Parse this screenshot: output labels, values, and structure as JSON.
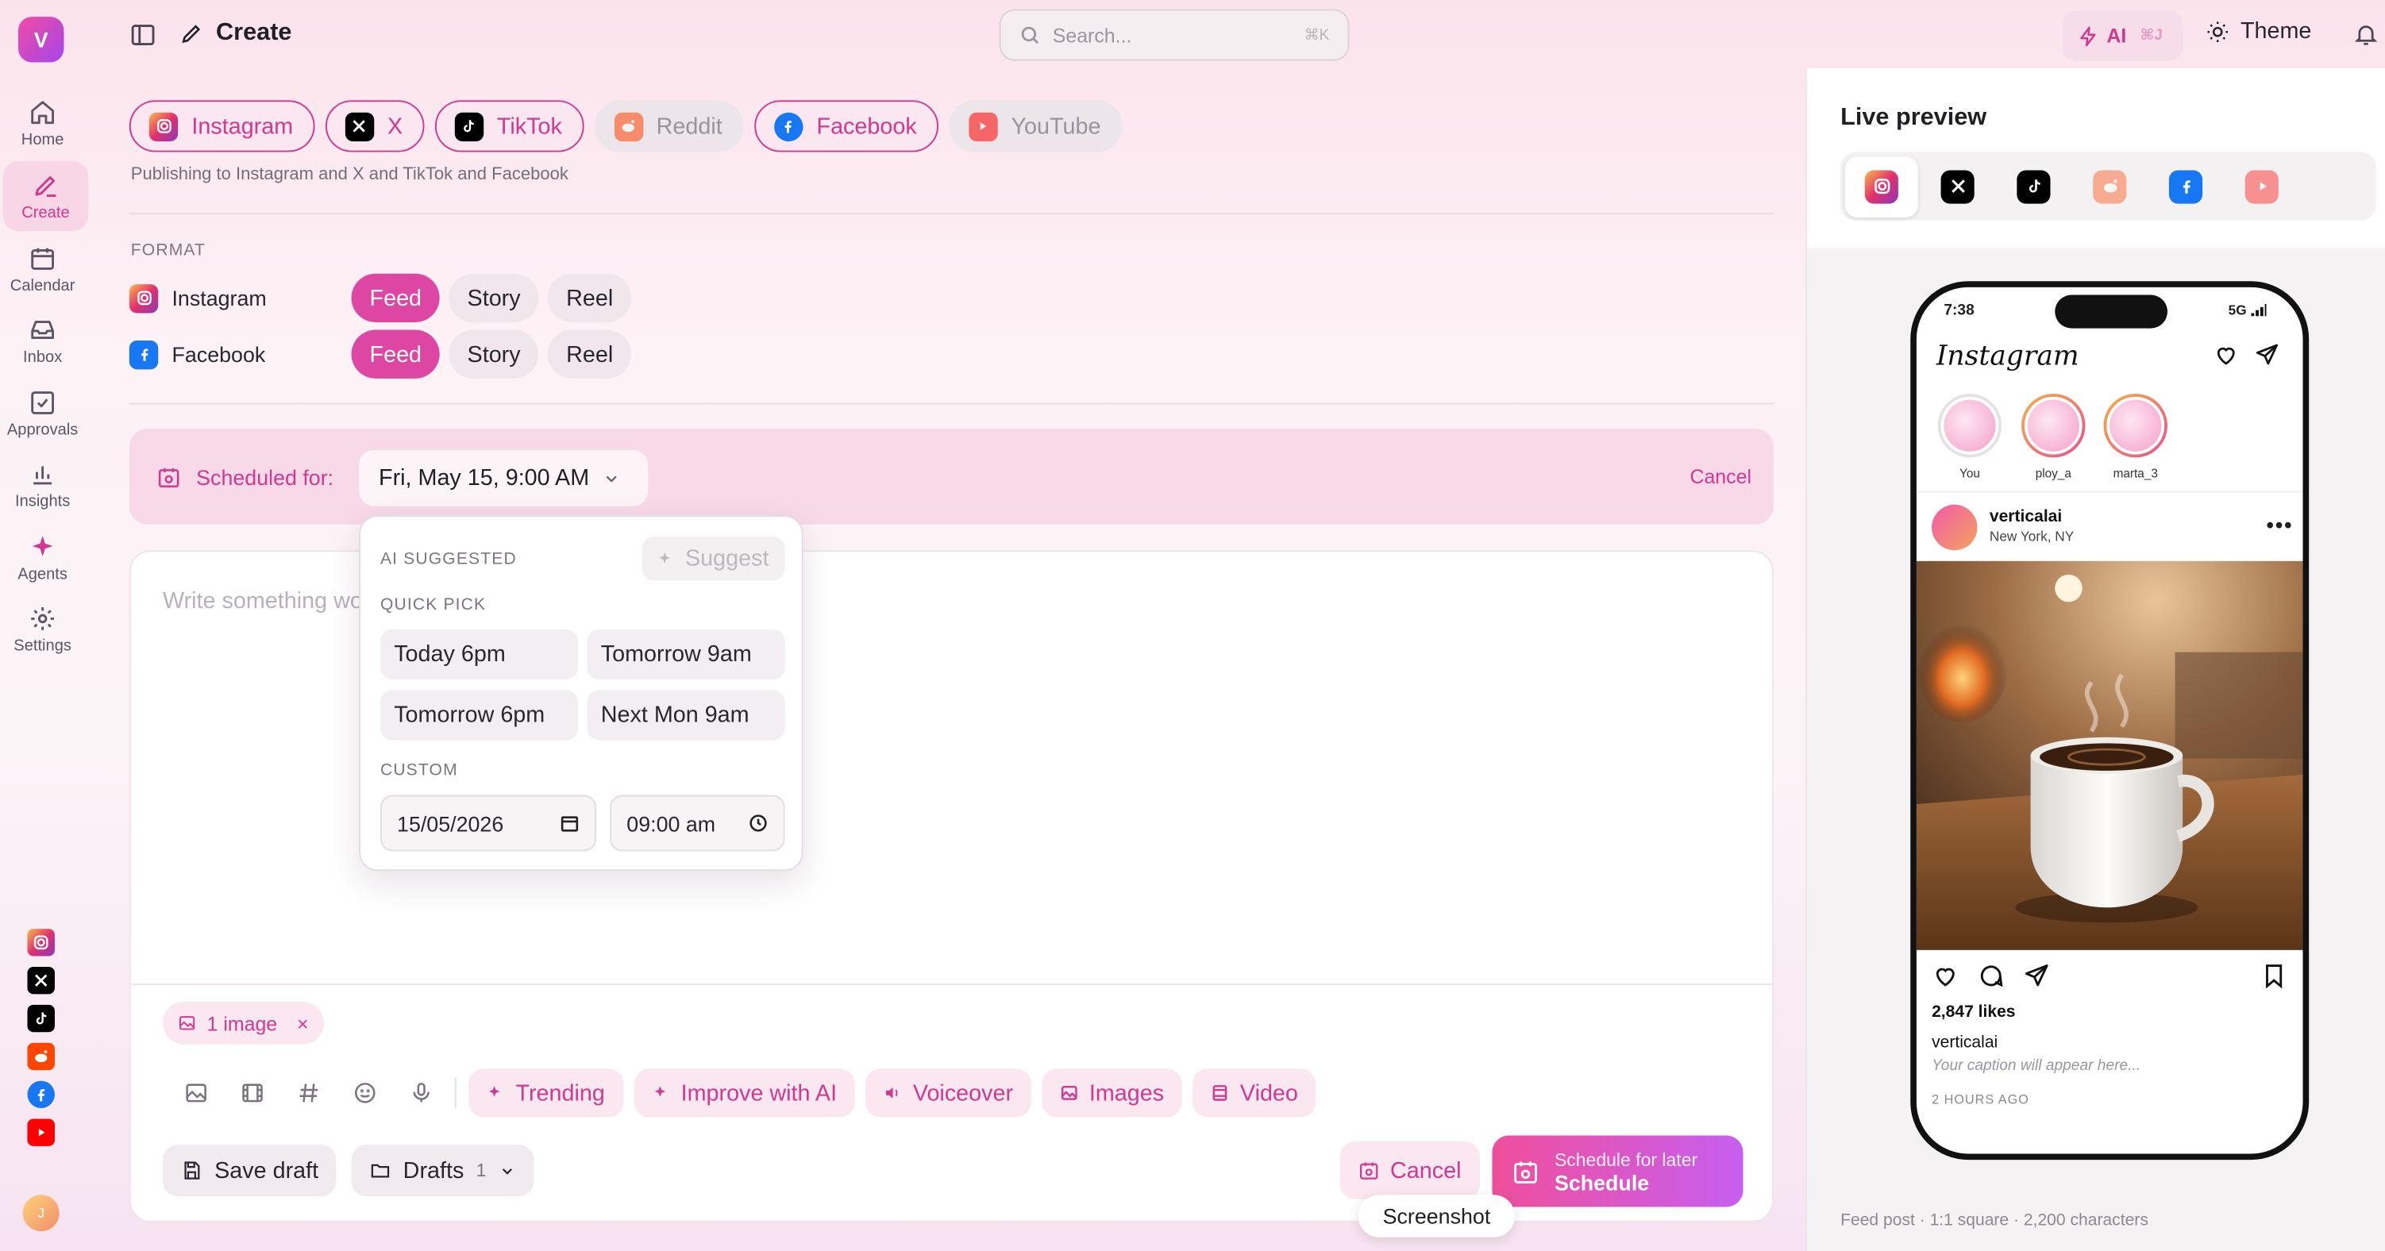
{
  "app": {
    "logo_letter": "V",
    "user_initial": "J"
  },
  "sidebar": {
    "items": [
      {
        "label": "Home",
        "icon": "home-icon"
      },
      {
        "label": "Create",
        "icon": "pencil-icon"
      },
      {
        "label": "Calendar",
        "icon": "calendar-icon"
      },
      {
        "label": "Inbox",
        "icon": "inbox-icon"
      },
      {
        "label": "Approvals",
        "icon": "check-square-icon"
      },
      {
        "label": "Insights",
        "icon": "bar-chart-icon"
      },
      {
        "label": "Agents",
        "icon": "sparkle-icon"
      },
      {
        "label": "Settings",
        "icon": "gear-icon"
      }
    ],
    "active": "Create"
  },
  "header": {
    "title": "Create",
    "search_placeholder": "Search...",
    "search_shortcut": "⌘K",
    "ai_label": "AI",
    "ai_shortcut": "⌘J",
    "theme_label": "Theme"
  },
  "platforms": {
    "chips": [
      {
        "label": "Instagram",
        "selected": true
      },
      {
        "label": "X",
        "selected": true
      },
      {
        "label": "TikTok",
        "selected": true
      },
      {
        "label": "Reddit",
        "selected": false
      },
      {
        "label": "Facebook",
        "selected": true
      },
      {
        "label": "YouTube",
        "selected": false
      }
    ],
    "publishing_text": "Publishing to Instagram and X and TikTok and Facebook"
  },
  "format": {
    "label": "FORMAT",
    "rows": [
      {
        "platform": "Instagram",
        "options": [
          "Feed",
          "Story",
          "Reel"
        ],
        "selected": "Feed"
      },
      {
        "platform": "Facebook",
        "options": [
          "Feed",
          "Story",
          "Reel"
        ],
        "selected": "Feed"
      }
    ]
  },
  "schedule": {
    "label": "Scheduled for:",
    "value": "Fri, May 15, 9:00 AM",
    "cancel": "Cancel",
    "dropdown": {
      "ai_label": "AI SUGGESTED",
      "suggest_label": "Suggest",
      "quick_label": "QUICK PICK",
      "quick": [
        "Today 6pm",
        "Tomorrow 9am",
        "Tomorrow 6pm",
        "Next Mon 9am"
      ],
      "custom_label": "CUSTOM",
      "date": "15/05/2026",
      "time": "09:00 am"
    }
  },
  "editor": {
    "placeholder": "Write something wo",
    "attachment": "1 image",
    "ai_tools": [
      "Trending",
      "Improve with AI",
      "Voiceover",
      "Images",
      "Video"
    ],
    "save_draft": "Save draft",
    "drafts": "Drafts",
    "drafts_count": "1",
    "cancel": "Cancel",
    "primary_sub": "Schedule for later",
    "primary_main": "Schedule",
    "tooltip": "Screenshot"
  },
  "preview": {
    "title": "Live preview",
    "time": "7:38",
    "network": "5G",
    "app_name": "Instagram",
    "stories": [
      "You",
      "ploy_a",
      "marta_3"
    ],
    "username": "verticalai",
    "location": "New York, NY",
    "likes": "2,847 likes",
    "caption_user": "verticalai",
    "caption_placeholder": "Your caption will appear here...",
    "time_ago": "2 HOURS AGO",
    "footer": "Feed post · 1:1 square · 2,200 characters"
  },
  "colors": {
    "accent": "#d0398f",
    "instagram": "#e1306c",
    "x": "#000000",
    "tiktok": "#000000",
    "reddit": "#ff4500",
    "facebook": "#1877f2",
    "youtube": "#ff0000"
  }
}
